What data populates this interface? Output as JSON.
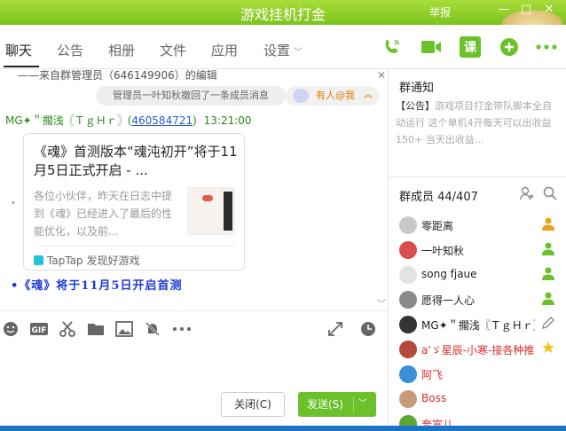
{
  "window": {
    "title": "游戏挂机打金",
    "report_label": "举报",
    "minimize_glyph": "—",
    "maximize_glyph": "□",
    "close_glyph": "✕"
  },
  "tabs": [
    {
      "label": "聊天"
    },
    {
      "label": "公告"
    },
    {
      "label": "相册"
    },
    {
      "label": "文件"
    },
    {
      "label": "应用"
    },
    {
      "label": "设置"
    }
  ],
  "toolbar_icons": {
    "phone": "phone-icon",
    "video": "video-icon",
    "class_label": "课",
    "add": "add-icon",
    "more": "more-icon",
    "accent_color": "#6cc12b"
  },
  "chat": {
    "system_line": "——来自群管理员（646149906）的编辑",
    "recall_notice": "管理员一叶知秋撤回了一条成员消息",
    "mention_label": "有人@我",
    "message": {
      "sender_name": "MG✦＂擱浅〖ＴｇＨｒ〗(",
      "sender_id": "460584721",
      "sender_close": ")",
      "time": "13:21:00"
    },
    "card": {
      "title": "《魂》首测版本“魂沌初开”将于11月5日正式开启 - ...",
      "description": "各位小伙伴，昨天在日志中提到《魂》已经进入了最后的性能优化，以及前...",
      "source": "TapTap 发现好游戏"
    },
    "link_message": "•《魂》将于11月5日开启首测"
  },
  "compose": {
    "close_label": "关闭(C)",
    "send_label": "发送(S)"
  },
  "notice": {
    "title": "群通知",
    "tag": "【公告】",
    "body": "游戏项目打金带队脚本全自动运行 这个单机4开每天可以出收益150+ 当天出收益..."
  },
  "members": {
    "title": "群成员 44/407",
    "list": [
      {
        "name": "零距离",
        "red": false,
        "avatar_color": "#c9c9c9"
      },
      {
        "name": "一叶知秋",
        "red": false,
        "avatar_color": "#d94d4d"
      },
      {
        "name": "song fjaue",
        "red": false,
        "avatar_color": "#e3e3e3"
      },
      {
        "name": "愿得一人心",
        "red": false,
        "avatar_color": "#8a8a8a"
      },
      {
        "name": "MG✦＂擱浅〖ＴｇＨｒ〗",
        "red": false,
        "avatar_color": "#333333"
      },
      {
        "name": "a'ゞ星辰-小寒-接各种推",
        "red": true,
        "avatar_color": "#b54a3a"
      },
      {
        "name": "阿飞",
        "red": true,
        "avatar_color": "#3b8fd9"
      },
      {
        "name": "Boss",
        "red": true,
        "avatar_color": "#c99a7a"
      },
      {
        "name": "奔富儿",
        "red": true,
        "avatar_color": "#5aa832"
      }
    ]
  }
}
